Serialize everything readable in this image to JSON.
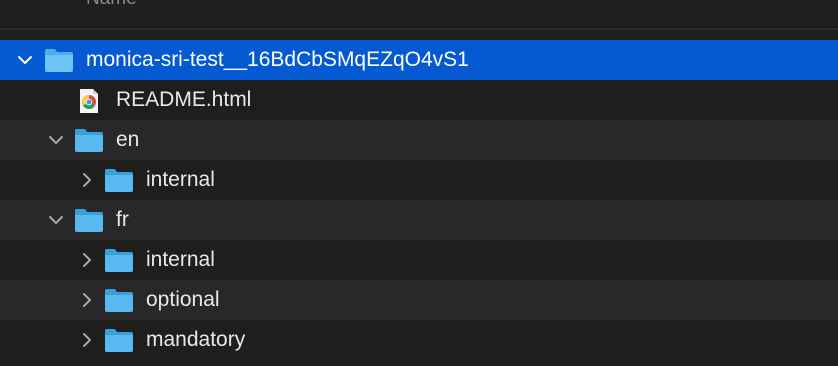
{
  "header": {
    "column_name": "Name"
  },
  "rows": [
    {
      "label": "monica-sri-test__16BdCbSMqEZqO4vS1",
      "type": "folder",
      "expanded": true,
      "selected": true,
      "icon": "folder-icon"
    },
    {
      "label": "README.html",
      "type": "file",
      "icon": "chrome-html-file-icon"
    },
    {
      "label": "en",
      "type": "folder",
      "expanded": true,
      "icon": "folder-icon"
    },
    {
      "label": "internal",
      "type": "folder",
      "expanded": false,
      "icon": "folder-icon"
    },
    {
      "label": "fr",
      "type": "folder",
      "expanded": true,
      "icon": "folder-icon"
    },
    {
      "label": "internal",
      "type": "folder",
      "expanded": false,
      "icon": "folder-icon"
    },
    {
      "label": "optional",
      "type": "folder",
      "expanded": false,
      "icon": "folder-icon"
    },
    {
      "label": "mandatory",
      "type": "folder",
      "expanded": false,
      "icon": "folder-icon"
    }
  ],
  "colors": {
    "selection": "#0559d1",
    "folder": "#5ab8f0",
    "background": "#1e1e1e",
    "stripe": "#282828"
  }
}
